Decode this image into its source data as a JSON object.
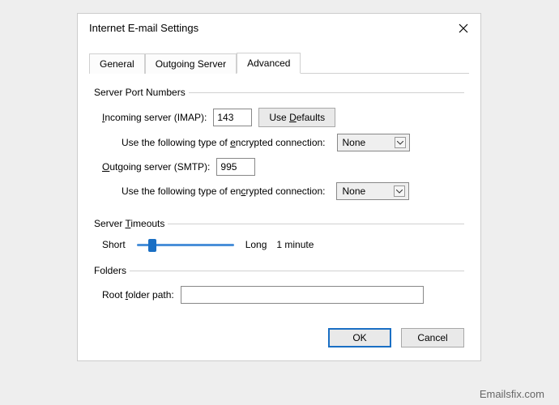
{
  "dialog": {
    "title": "Internet E-mail Settings"
  },
  "tabs": {
    "general": "General",
    "outgoing": "Outgoing Server",
    "advanced": "Advanced"
  },
  "ports": {
    "legend": "Server Port Numbers",
    "incoming_pre": "I",
    "incoming_label": "ncoming server (IMAP):",
    "incoming_value": "143",
    "defaults_pre": "Use ",
    "defaults_u": "D",
    "defaults_post": "efaults",
    "enc_in_pre": "Use the following type of ",
    "enc_in_u": "e",
    "enc_in_post": "ncrypted connection:",
    "enc_in_value": "None",
    "outgoing_u": "O",
    "outgoing_label": "utgoing server (SMTP):",
    "outgoing_value": "995",
    "enc_out_pre": "Use the following type of en",
    "enc_out_u": "c",
    "enc_out_post": "rypted connection:",
    "enc_out_value": "None"
  },
  "timeouts": {
    "legend_pre": "Server ",
    "legend_u": "T",
    "legend_post": "imeouts",
    "short": "Short",
    "long": "Long",
    "value": "1 minute"
  },
  "folders": {
    "legend": "Folders",
    "label_pre": "Root ",
    "label_u": "f",
    "label_post": "older path:",
    "value": ""
  },
  "buttons": {
    "ok": "OK",
    "cancel": "Cancel"
  },
  "watermark": "Emailsfix.com"
}
